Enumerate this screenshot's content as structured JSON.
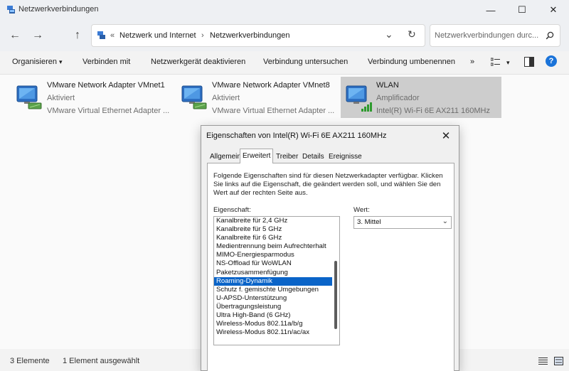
{
  "window": {
    "title": "Netzwerkverbindungen",
    "minimize": "—",
    "maximize": "☐",
    "close": "✕"
  },
  "nav": {
    "back": "←",
    "forward": "→",
    "up": "↑",
    "refresh": "↻",
    "breadcrumb_sep_root": "«",
    "crumb1": "Netzwerk und Internet",
    "crumb_sep": "›",
    "crumb2": "Netzwerkverbindungen",
    "dropdown": "⌄"
  },
  "search": {
    "placeholder": "Netzwerkverbindungen durc...",
    "icon": "search-icon"
  },
  "toolbar": {
    "organize": "Organisieren",
    "organize_arrow": "▾",
    "connect": "Verbinden mit",
    "disable": "Netzwerkgerät deaktivieren",
    "diagnose": "Verbindung untersuchen",
    "rename": "Verbindung umbenennen",
    "more": "»",
    "view_arrow": "▾",
    "help": "?"
  },
  "adapters": [
    {
      "name": "VMware Network Adapter VMnet1",
      "status": "Aktiviert",
      "device": "VMware Virtual Ethernet Adapter ...",
      "selected": false
    },
    {
      "name": "VMware Network Adapter VMnet8",
      "status": "Aktiviert",
      "device": "VMware Virtual Ethernet Adapter ...",
      "selected": false
    },
    {
      "name": "WLAN",
      "status": "Amplificador",
      "device": "Intel(R) Wi-Fi 6E AX211 160MHz",
      "selected": true
    }
  ],
  "statusbar": {
    "count": "3 Elemente",
    "selected": "1 Element ausgewählt"
  },
  "dialog": {
    "title": "Eigenschaften von Intel(R) Wi-Fi 6E AX211 160MHz",
    "close": "✕",
    "tabs": [
      "Allgemein",
      "Erweitert",
      "Treiber",
      "Details",
      "Ereignisse"
    ],
    "active_tab": "Erweitert",
    "description": "Folgende Eigenschaften sind für diesen Netzwerkadapter verfügbar. Klicken Sie links auf die Eigenschaft, die geändert werden soll, und wählen Sie den Wert auf der rechten Seite aus.",
    "property_label": "Eigenschaft:",
    "value_label": "Wert:",
    "properties": [
      "Kanalbreite für 2,4 GHz",
      "Kanalbreite für 5 GHz",
      "Kanalbreite für 6 GHz",
      "Medientrennung beim Aufrechterhalt",
      "MIMO-Energiesparmodus",
      "NS-Offload für WoWLAN",
      "Paketzusammenfügung",
      "Roaming-Dynamik",
      "Schutz f. gemischte Umgebungen",
      "U-APSD-Unterstützung",
      "Übertragungsleistung",
      "Ultra High-Band (6 GHz)",
      "Wireless-Modus 802.11a/b/g",
      "Wireless-Modus 802.11n/ac/ax"
    ],
    "selected_property": "Roaming-Dynamik",
    "value": "3. Mittel"
  }
}
